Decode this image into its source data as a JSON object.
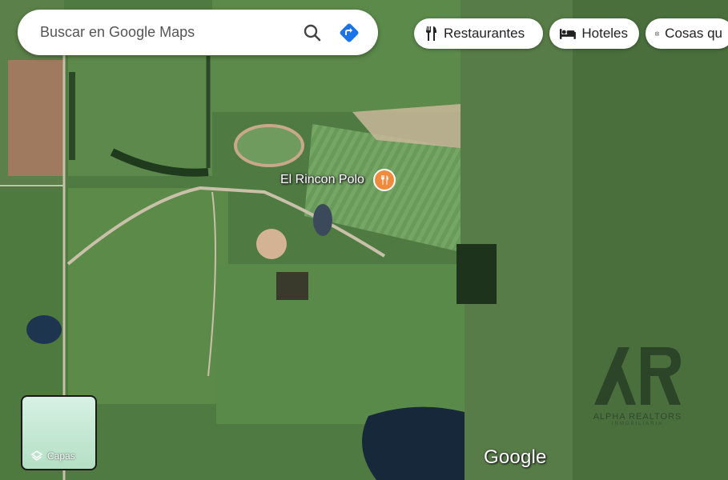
{
  "search": {
    "placeholder": "Buscar en Google Maps",
    "search_icon": "search-icon",
    "directions_icon": "directions-icon"
  },
  "chips": [
    {
      "label": "Restaurantes",
      "icon": "fork-knife-icon"
    },
    {
      "label": "Hoteles",
      "icon": "bed-icon"
    },
    {
      "label": "Cosas qu",
      "icon": "camera-icon"
    }
  ],
  "place": {
    "name": "El Rincon Polo",
    "icon": "restaurant-pin-icon"
  },
  "layers": {
    "label": "Capas",
    "icon": "layers-icon"
  },
  "brand": {
    "wordmark": "Google"
  },
  "watermark": {
    "name": "ALPHA REALTORS",
    "sub": "INMOBILIARIA"
  },
  "colors": {
    "accent": "#1a73e8",
    "pin": "#f08a3c"
  }
}
